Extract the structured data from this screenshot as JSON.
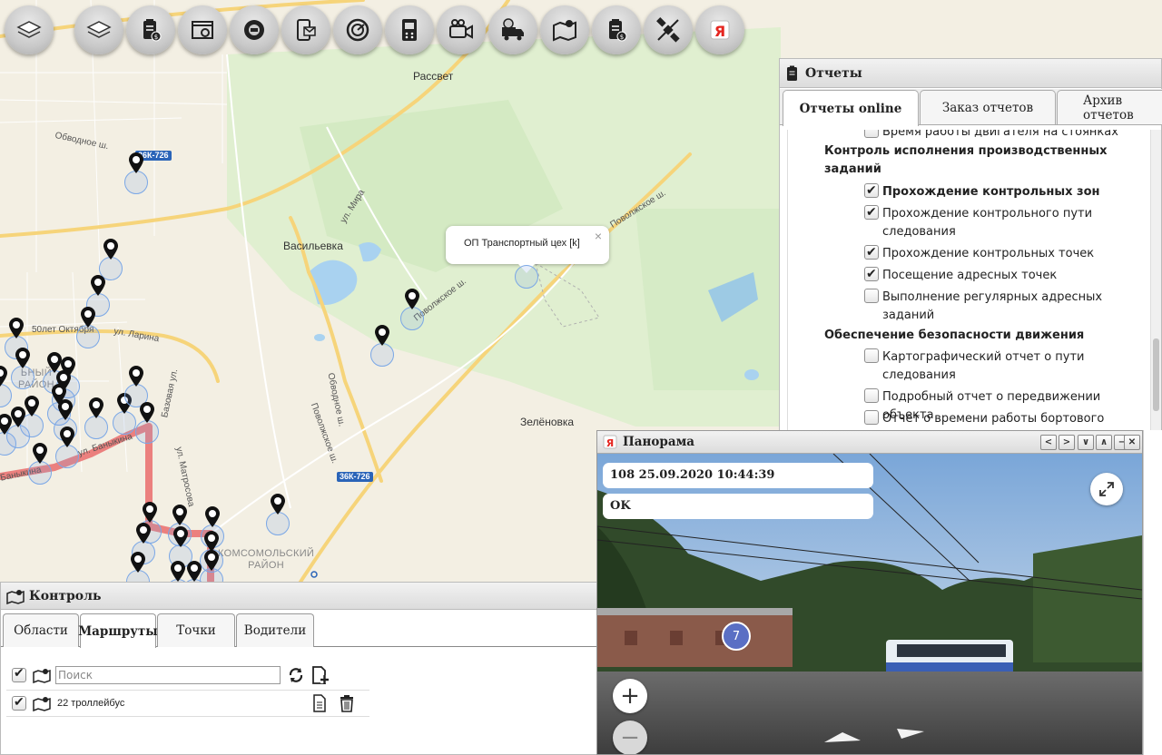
{
  "toolbar": {
    "buttons": [
      {
        "icon": "layers-icon"
      },
      {
        "icon": "layers-alt-icon"
      },
      {
        "icon": "billing-clipboard-icon"
      },
      {
        "icon": "browser-settings-icon"
      },
      {
        "icon": "car-gear-icon"
      },
      {
        "icon": "phone-mail-icon"
      },
      {
        "icon": "speedometer-icon"
      },
      {
        "icon": "terminal-device-icon"
      },
      {
        "icon": "video-camera-icon"
      },
      {
        "icon": "truck-clock-icon"
      },
      {
        "icon": "map-route-icon"
      },
      {
        "icon": "report-clipboard-icon"
      },
      {
        "icon": "satellite-icon"
      },
      {
        "icon": "yandex-icon",
        "glyph": "Я"
      }
    ]
  },
  "map": {
    "labels": {
      "rassvet": "Рассвет",
      "vasilevka": "Васильевка",
      "zelenovka": "Зелёновка",
      "obvodnoe": "Обводное ш.",
      "obvodnoe2": "Обводное ш.",
      "povolzhskoe1": "Поволжское ш.",
      "povolzhskoe2": "Поволжское ш.",
      "povolzhskoe3": "Поволжское ш.",
      "mira": "ул. Мира",
      "larina": "ул. Ларина",
      "bazovaya": "Базовая ул.",
      "matrosova": "ул. Матросова",
      "banykina": "ул. Баныкина",
      "banykina2": "Баныкина",
      "let_oktyabrya": "50лет Октября",
      "district_komsomolsky": "КОМСОМОЛЬСКИЙ\nРАЙОН",
      "district_left": "ЬНЫЙ\nРАЙОН"
    },
    "road_badges": {
      "r1": "36К-726",
      "r2": "36К-726"
    },
    "balloon": {
      "text": "ОП Транспортный цех [k]",
      "close": "×"
    }
  },
  "reports": {
    "title": "Отчеты",
    "tabs": [
      {
        "label": "Отчеты online",
        "active": true
      },
      {
        "label": "Заказ отчетов",
        "active": false
      },
      {
        "label": "Архив отчетов",
        "active": false
      }
    ],
    "items": [
      {
        "type": "check",
        "label": "Время работы двигателя на стоянках",
        "checked": false,
        "bold": false
      },
      {
        "type": "group",
        "label": "Контроль исполнения производственных заданий"
      },
      {
        "type": "check",
        "label": "Прохождение контрольных зон",
        "checked": true,
        "bold": true
      },
      {
        "type": "check",
        "label": "Прохождение контрольного пути следования",
        "checked": true,
        "bold": false
      },
      {
        "type": "check",
        "label": "Прохождение контрольных точек",
        "checked": true,
        "bold": false
      },
      {
        "type": "check",
        "label": "Посещение адресных точек",
        "checked": true,
        "bold": false
      },
      {
        "type": "check",
        "label": "Выполнение регулярных адресных заданий",
        "checked": false,
        "bold": false
      },
      {
        "type": "group",
        "label": "Обеспечение безопасности движения"
      },
      {
        "type": "check",
        "label": "Картографический отчет о пути следования",
        "checked": false,
        "bold": false
      },
      {
        "type": "check",
        "label": "Подробный отчет о передвижении объекта",
        "checked": false,
        "bold": false
      },
      {
        "type": "check",
        "label": "Отчет о времени работы бортового",
        "checked": false,
        "bold": false
      }
    ]
  },
  "control": {
    "title": "Контроль",
    "tabs": [
      {
        "label": "Области",
        "active": false
      },
      {
        "label": "Маршруты",
        "active": true
      },
      {
        "label": "Точки",
        "active": false
      },
      {
        "label": "Водители",
        "active": false
      }
    ],
    "search_placeholder": "Поиск",
    "routes": [
      {
        "label": "22 троллейбус",
        "checked": true
      }
    ]
  },
  "panorama": {
    "title": "Панорама",
    "info_line1": "108 25.09.2020 10:44:39",
    "info_line2": "OK",
    "marker_number": "7",
    "zoom_in": "+",
    "zoom_out": "−",
    "window_buttons": [
      "<",
      ">",
      "∨",
      "∧",
      "−",
      "✕"
    ]
  }
}
